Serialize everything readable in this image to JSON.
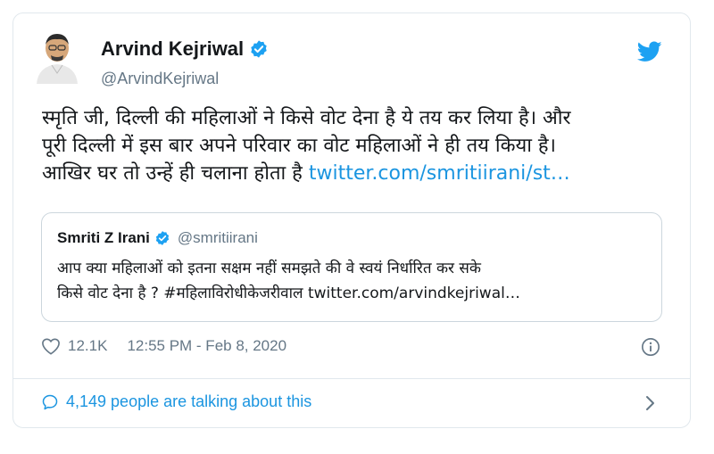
{
  "author": {
    "name": "Arvind Kejriwal",
    "handle": "@ArvindKejriwal",
    "verified": true
  },
  "tweet": {
    "line1": "स्मृति जी, दिल्ली की महिलाओं ने किसे वोट देना है ये तय कर लिया है। और",
    "line2": "पूरी दिल्ली में इस बार अपने परिवार का वोट महिलाओं ने ही तय किया है।",
    "line3": "आखिर घर तो उन्हें ही चलाना होता है",
    "link": "twitter.com/smritiirani/st…"
  },
  "quote": {
    "name": "Smriti Z Irani",
    "handle": "@smritiirani",
    "verified": true,
    "line1": "आप क्या महिलाओं को इतना सक्षम नहीं समझते की वे स्वयं निर्धारित कर सके",
    "line2": "किसे वोट देना है ? #महिलाविरोधीकेजरीवाल twitter.com/arvindkejriwal…"
  },
  "meta": {
    "likes": "12.1K",
    "timestamp": "12:55 PM - Feb 8, 2020"
  },
  "footer": {
    "conversation": "4,149 people are talking about this"
  },
  "colors": {
    "accent": "#1da1f2",
    "link": "#1b95e0",
    "secondary_text": "#657786",
    "border": "#e1e8ed"
  },
  "icons": [
    "verified-badge-icon",
    "twitter-bird-icon",
    "heart-icon",
    "info-icon",
    "speech-bubble-icon",
    "chevron-right-icon"
  ]
}
